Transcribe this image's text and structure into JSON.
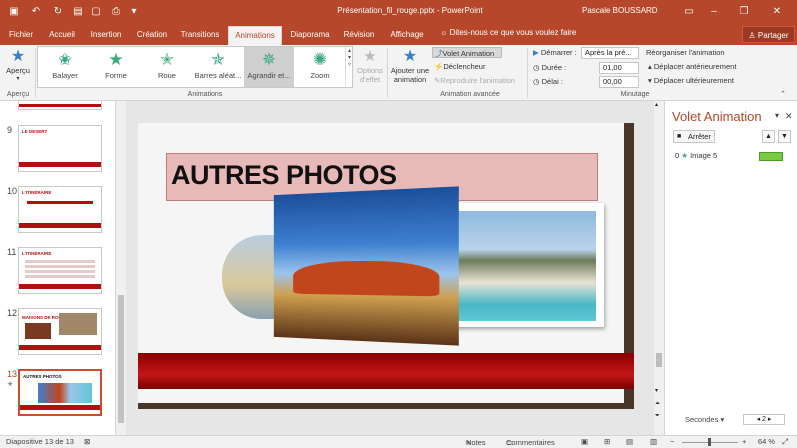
{
  "app": {
    "document_title": "Présentation_fil_rouge.pptx - PowerPoint",
    "user": "Pascale BOUSSARD"
  },
  "tabs": [
    {
      "label": "Fichier"
    },
    {
      "label": "Accueil"
    },
    {
      "label": "Insertion"
    },
    {
      "label": "Création"
    },
    {
      "label": "Transitions"
    },
    {
      "label": "Animations",
      "active": true
    },
    {
      "label": "Diaporama"
    },
    {
      "label": "Révision"
    },
    {
      "label": "Affichage"
    }
  ],
  "tell_me": "Dites-nous ce que vous voulez faire",
  "share": "Partager",
  "ribbon": {
    "preview": "Aperçu",
    "group_preview": "Aperçu",
    "gallery": [
      "Balayer",
      "Forme",
      "Roue",
      "Barres aléat...",
      "Agrandir et...",
      "Zoom"
    ],
    "gallery_selected": "Agrandir et...",
    "effect_options": "Options d'effet",
    "group_animations": "Animations",
    "add_animation": "Ajouter une animation",
    "animation_pane": "Volet Animation",
    "trigger": "Déclencheur",
    "copy_animation": "Reproduire l'animation",
    "group_advanced": "Animation avancée",
    "start_label": "Démarrer :",
    "start_value": "Après la pré...",
    "duration_label": "Durée :",
    "duration_value": "01,00",
    "delay_label": "Délai :",
    "delay_value": "00,00",
    "reorder": "Réorganiser l'animation",
    "move_earlier": "Déplacer antérieurement",
    "move_later": "Déplacer ultérieurement",
    "group_timing": "Minutage"
  },
  "slides": [
    {
      "number": "9",
      "title": "LE DESERT"
    },
    {
      "number": "10",
      "title": "L'ITINÉRAIRE"
    },
    {
      "number": "11",
      "title": "L'ITINÉRAIRE"
    },
    {
      "number": "12",
      "title": "MAISONS DE ROCHE"
    },
    {
      "number": "13",
      "title": "AUTRES PHOTOS",
      "current": true
    }
  ],
  "slide": {
    "title": "AUTRES PHOTOS"
  },
  "pane": {
    "title": "Volet Animation",
    "play_button": "Arrêter",
    "items": [
      {
        "order": "0",
        "name": "Image 5"
      }
    ],
    "seconds_label": "Secondes",
    "zoom_value": "2"
  },
  "status": {
    "slide_info": "Diapositive 13 de 13",
    "notes": "Notes",
    "comments": "Commentaires",
    "zoom": "64 %"
  },
  "colors": {
    "accent": "#b7472a",
    "star_green": "#3bab7f",
    "slide_red": "#b01010"
  }
}
